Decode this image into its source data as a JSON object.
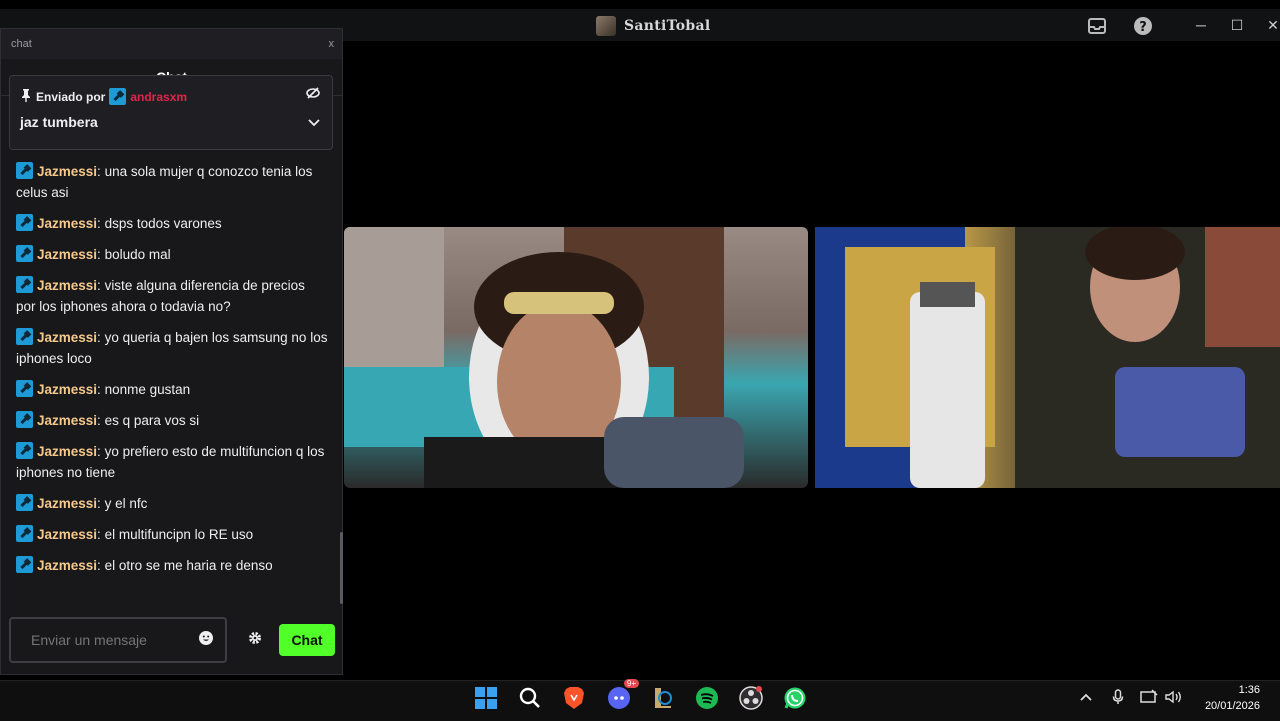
{
  "window": {
    "title": "SantiTobal"
  },
  "chat": {
    "window_label": "chat",
    "close_label": "x",
    "header": "Chat",
    "pinned": {
      "sent_by_label": "Enviado por",
      "user": "andrasxm",
      "message": "jaz tumbera"
    },
    "messages": [
      {
        "user": "Jazmessi",
        "text": "una sola mujer q conozco tenia los celus asi"
      },
      {
        "user": "Jazmessi",
        "text": "dsps todos varones"
      },
      {
        "user": "Jazmessi",
        "text": "boludo mal"
      },
      {
        "user": "Jazmessi",
        "text": "viste alguna diferencia de precios por los iphones ahora o todavia no?"
      },
      {
        "user": "Jazmessi",
        "text": "yo queria q bajen los samsung no los iphones loco"
      },
      {
        "user": "Jazmessi",
        "text": "nonme gustan"
      },
      {
        "user": "Jazmessi",
        "text": "es q para vos si"
      },
      {
        "user": "Jazmessi",
        "text": "yo prefiero esto de multifuncion q los iphones no tiene"
      },
      {
        "user": "Jazmessi",
        "text": "y el nfc"
      },
      {
        "user": "Jazmessi",
        "text": "el multifuncipn lo RE uso"
      },
      {
        "user": "Jazmessi",
        "text": "el otro se me haria re denso"
      }
    ],
    "input_placeholder": "Enviar un mensaje",
    "send_label": "Chat"
  },
  "taskbar": {
    "discord_badge": "9+",
    "time": "1:36",
    "date": "20/01/2026"
  },
  "colors": {
    "accent_green": "#51ff29",
    "pinned_user": "#e0244c",
    "chat_user": "#f6c98a"
  }
}
